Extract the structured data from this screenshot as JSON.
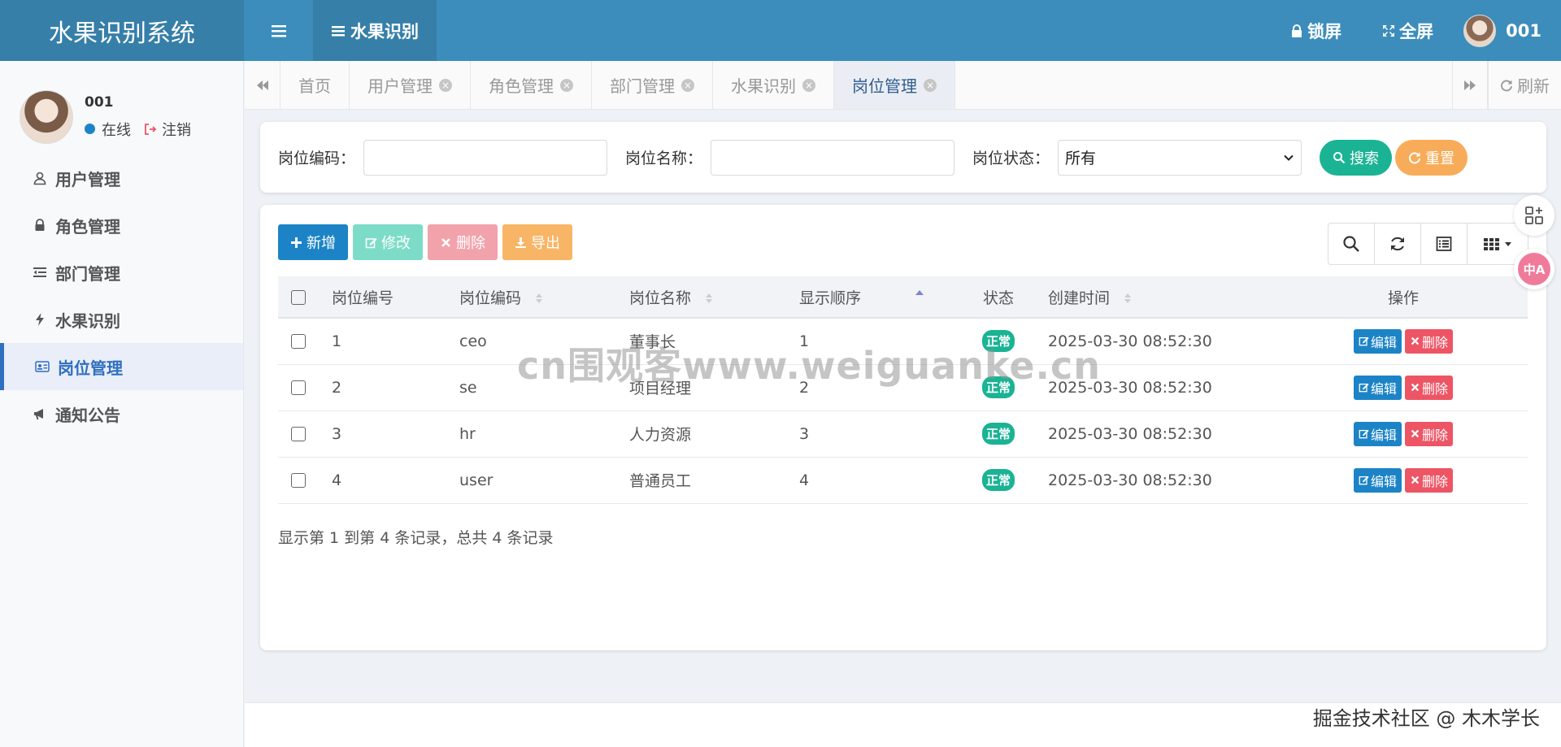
{
  "app": {
    "title": "水果识别系统"
  },
  "header": {
    "module": "水果识别",
    "lock_label": "锁屏",
    "fullscreen_label": "全屏",
    "username": "001"
  },
  "sidebar": {
    "user": {
      "name": "001",
      "status": "在线",
      "logout": "注销"
    },
    "items": [
      {
        "label": "用户管理",
        "icon": "user-icon"
      },
      {
        "label": "角色管理",
        "icon": "role-icon"
      },
      {
        "label": "部门管理",
        "icon": "outdent-icon"
      },
      {
        "label": "水果识别",
        "icon": "bolt-icon"
      },
      {
        "label": "岗位管理",
        "icon": "id-card-icon",
        "active": true
      },
      {
        "label": "通知公告",
        "icon": "bullhorn-icon"
      }
    ]
  },
  "tabs": {
    "items": [
      {
        "label": "首页",
        "closable": false
      },
      {
        "label": "用户管理",
        "closable": true
      },
      {
        "label": "角色管理",
        "closable": true
      },
      {
        "label": "部门管理",
        "closable": true
      },
      {
        "label": "水果识别",
        "closable": true
      },
      {
        "label": "岗位管理",
        "closable": true,
        "active": true
      }
    ],
    "refresh_label": "刷新"
  },
  "search": {
    "code_label": "岗位编码：",
    "code_value": "",
    "name_label": "岗位名称：",
    "name_value": "",
    "status_label": "岗位状态：",
    "status_value": "所有",
    "search_label": "搜索",
    "reset_label": "重置"
  },
  "toolbar": {
    "add": "新增",
    "edit": "修改",
    "delete": "删除",
    "export": "导出"
  },
  "table": {
    "columns": [
      "岗位编号",
      "岗位编码",
      "岗位名称",
      "显示顺序",
      "状态",
      "创建时间",
      "操作"
    ],
    "rows": [
      {
        "id": "1",
        "code": "ceo",
        "name": "董事长",
        "order": "1",
        "status": "正常",
        "created": "2025-03-30 08:52:30"
      },
      {
        "id": "2",
        "code": "se",
        "name": "项目经理",
        "order": "2",
        "status": "正常",
        "created": "2025-03-30 08:52:30"
      },
      {
        "id": "3",
        "code": "hr",
        "name": "人力资源",
        "order": "3",
        "status": "正常",
        "created": "2025-03-30 08:52:30"
      },
      {
        "id": "4",
        "code": "user",
        "name": "普通员工",
        "order": "4",
        "status": "正常",
        "created": "2025-03-30 08:52:30"
      }
    ],
    "row_edit": "编辑",
    "row_delete": "删除",
    "pagination": "显示第 1 到第 4 条记录，总共 4 条记录"
  },
  "float": {
    "translate_label": "中A"
  },
  "watermark": "cn围观客www.weiguanke.cn",
  "attribution": "掘金技术社区 @ 木木学长",
  "colors": {
    "header": "#3c8dbc",
    "primary": "#1c84c6",
    "success": "#1ab394",
    "warning": "#f8ac59",
    "danger": "#ed5565"
  }
}
